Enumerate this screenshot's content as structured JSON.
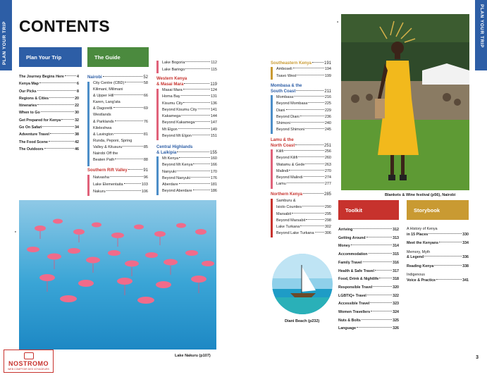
{
  "side_tabs": {
    "left": "PLAN YOUR TRIP",
    "right": "PLAN YOUR TRIP"
  },
  "title": "CONTENTS",
  "colors": {
    "blue": "#2d5ea6",
    "green": "#4b8a3e",
    "pink": "#e0627a",
    "teal": "#4d8ec8",
    "red": "#c7322d",
    "gold": "#c99a32",
    "orange": "#e07a3a"
  },
  "plan_tab": "Plan Your Trip",
  "guide_tab": "The Guide",
  "toolkit_tab": "Toolkit",
  "storybook_tab": "Storybook",
  "plan": [
    {
      "label": "The Journey Begins Here",
      "page": "4"
    },
    {
      "label": "Kenya Map",
      "page": "6"
    },
    {
      "label": "Our Picks",
      "page": "8"
    },
    {
      "label": "Regions & Cities",
      "page": "20"
    },
    {
      "label": "Itineraries",
      "page": "22"
    },
    {
      "label": "When to Go",
      "page": "30"
    },
    {
      "label": "Get Prepared for Kenya",
      "page": "32"
    },
    {
      "label": "Go On Safari",
      "page": "34"
    },
    {
      "label": "Adventure Travel",
      "page": "38"
    },
    {
      "label": "The Food Scene",
      "page": "42"
    },
    {
      "label": "The Outdoors",
      "page": "46"
    }
  ],
  "nairobi": {
    "heading": "Nairobi",
    "heading_page": "52",
    "items": [
      {
        "label": "City Centre (CBD)",
        "page": "58"
      },
      {
        "label": "Kilimani, Milimani",
        "page": ""
      },
      {
        "label": "& Upper Hill",
        "page": "66"
      },
      {
        "label": "Karen, Lang'ata",
        "page": ""
      },
      {
        "label": "& Dagoretti",
        "page": "69"
      },
      {
        "label": "Westlands",
        "page": ""
      },
      {
        "label": "& Parklands",
        "page": "76"
      },
      {
        "label": "Kileleshwa",
        "page": ""
      },
      {
        "label": "& Lavington",
        "page": "81"
      },
      {
        "label": "Runda, Peponi, Spring",
        "page": ""
      },
      {
        "label": "Valley & Kitusuru",
        "page": "85"
      },
      {
        "label": "Nairobi Off the",
        "page": ""
      },
      {
        "label": "Beaten Path",
        "page": "88"
      }
    ]
  },
  "rift": {
    "heading": "Southern Rift Valley",
    "heading_page": "91",
    "items": [
      {
        "label": "Naivasha",
        "page": "96"
      },
      {
        "label": "Lake Elementaita",
        "page": "103"
      },
      {
        "label": "Nakuru",
        "page": "106"
      }
    ]
  },
  "rift_more": [
    {
      "label": "Lake Bogoria",
      "page": "112"
    },
    {
      "label": "Lake Baringo",
      "page": "115"
    }
  ],
  "western": {
    "heading_1": "Western Kenya",
    "heading_2": "& Masai Mara",
    "heading_page": "119",
    "items": [
      {
        "label": "Masai Mara",
        "page": "124"
      },
      {
        "label": "Homa Bay",
        "page": "131"
      },
      {
        "label": "Kisumu City",
        "page": "136"
      },
      {
        "label": "Beyond Kisumu City",
        "page": "141"
      },
      {
        "label": "Kakamega",
        "page": "144"
      },
      {
        "label": "Beyond Kakamega",
        "page": "147"
      },
      {
        "label": "Mt Elgon",
        "page": "149"
      },
      {
        "label": "Beyond Mt Elgon",
        "page": "151"
      }
    ]
  },
  "central": {
    "heading_1": "Central Highlands",
    "heading_2": "& Laikipia",
    "heading_page": "155",
    "items": [
      {
        "label": "Mt Kenya",
        "page": "160"
      },
      {
        "label": "Beyond Mt Kenya",
        "page": "166"
      },
      {
        "label": "Nanyuki",
        "page": "170"
      },
      {
        "label": "Beyond Nanyuki",
        "page": "176"
      },
      {
        "label": "Aberdare",
        "page": "181"
      },
      {
        "label": "Beyond Aberdare",
        "page": "186"
      }
    ]
  },
  "southeastern": {
    "heading": "Southeastern Kenya",
    "heading_page": "191",
    "items": [
      {
        "label": "Amboseli",
        "page": "194"
      },
      {
        "label": "Tsavo West",
        "page": "199"
      }
    ]
  },
  "mombasa": {
    "heading_1": "Mombasa & the",
    "heading_2": "South Coast",
    "heading_page": "211",
    "items": [
      {
        "label": "Mombasa",
        "page": "216"
      },
      {
        "label": "Beyond Mombasa",
        "page": "225"
      },
      {
        "label": "Diani",
        "page": "229"
      },
      {
        "label": "Beyond Diani",
        "page": "236"
      },
      {
        "label": "Shimoni",
        "page": "240"
      },
      {
        "label": "Beyond Shimoni",
        "page": "245"
      }
    ]
  },
  "lamu": {
    "heading_1": "Lamu & the",
    "heading_2": "North Coast",
    "heading_page": "251",
    "items": [
      {
        "label": "Kilifi",
        "page": "256"
      },
      {
        "label": "Beyond Kilifi",
        "page": "260"
      },
      {
        "label": "Watamu & Gede",
        "page": "263"
      },
      {
        "label": "Malindi",
        "page": "270"
      },
      {
        "label": "Beyond Malindi",
        "page": "274"
      },
      {
        "label": "Lamu",
        "page": "277"
      }
    ]
  },
  "northern": {
    "heading": "Northern Kenya",
    "heading_page": "285",
    "items": [
      {
        "label": "Samburu &",
        "page": ""
      },
      {
        "label": "Isiolo Counties",
        "page": "290"
      },
      {
        "label": "Marsabit",
        "page": "295"
      },
      {
        "label": "Beyond Marsabit",
        "page": "298"
      },
      {
        "label": "Lake Turkana",
        "page": "302"
      },
      {
        "label": "Beyond Lake Turkana",
        "page": "306"
      }
    ]
  },
  "toolkit": [
    {
      "label": "Arriving",
      "page": "312"
    },
    {
      "label": "Getting Around",
      "page": "313"
    },
    {
      "label": "Money",
      "page": "314"
    },
    {
      "label": "Accommodation",
      "page": "315"
    },
    {
      "label": "Family Travel",
      "page": "316"
    },
    {
      "label": "Health & Safe Travel",
      "page": "317"
    },
    {
      "label": "Food, Drink & Nightlife",
      "page": "318"
    },
    {
      "label": "Responsible Travel",
      "page": "320"
    },
    {
      "label": "LGBTIQ+ Travel",
      "page": "322"
    },
    {
      "label": "Accessible Travel",
      "page": "323"
    },
    {
      "label": "Women Travellers",
      "page": "324"
    },
    {
      "label": "Nuts & Bolts",
      "page": "325"
    },
    {
      "label": "Language",
      "page": "326"
    }
  ],
  "storybook": [
    {
      "label_1": "A History of Kenya",
      "label_2": "in 15 Places",
      "page": "330"
    },
    {
      "label_1": "Meet the Kenyans",
      "label_2": "",
      "page": "334"
    },
    {
      "label_1": "Memory, Myth",
      "label_2": "& Legend",
      "page": "336"
    },
    {
      "label_1": "Reading Kenya",
      "label_2": "",
      "page": "338"
    },
    {
      "label_1": "Indigenous",
      "label_2": "Voice & Practice",
      "page": "341"
    }
  ],
  "captions": {
    "festival": "Blankets & Wine festival (p56), Nairobi",
    "diani": "Diani Beach (p232)",
    "nakuru": "Lake Nakuru (p107)"
  },
  "page_number": "3",
  "logo": {
    "name": "NOSTROMO",
    "tagline": "WEB COMPTOIR DES VOYAGEURS"
  }
}
